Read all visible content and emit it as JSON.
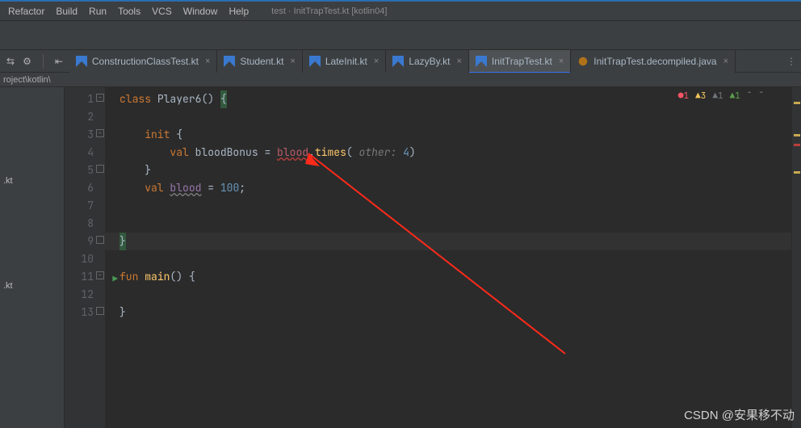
{
  "menu": {
    "items": [
      "Refactor",
      "Build",
      "Run",
      "Tools",
      "VCS",
      "Window",
      "Help"
    ],
    "title": "test · InitTrapTest.kt [kotlin04]"
  },
  "tabs": [
    {
      "label": "ConstructionClassTest.kt",
      "active": false
    },
    {
      "label": "Student.kt",
      "active": false
    },
    {
      "label": "LateInit.kt",
      "active": false
    },
    {
      "label": "LazyBy.kt",
      "active": false
    },
    {
      "label": "InitTrapTest.kt",
      "active": true
    },
    {
      "label": "InitTrapTest.decompiled.java",
      "active": false
    }
  ],
  "breadcrumb": "roject\\kotlin\\",
  "sidebar": {
    "items": [
      ".kt",
      ".kt"
    ],
    "positions": [
      128,
      260
    ]
  },
  "inspections": {
    "errors": "1",
    "warn": "3",
    "weak": "1",
    "typo": "1"
  },
  "code": {
    "l1": {
      "kw": "class",
      "name": "Player6",
      "par": "()",
      "brace": "{"
    },
    "l3": {
      "kw": "init",
      "brace": "{"
    },
    "l4": {
      "kw": "val",
      "v": "bloodBonus",
      "eq": " = ",
      "err": "blood",
      "dot": ".",
      "fn": "times",
      "lp": "(",
      "hint": " other: ",
      "num": "4",
      "rp": ")"
    },
    "l5": {
      "brace": "}"
    },
    "l6": {
      "kw": "val",
      "v": "blood",
      "eq": " = ",
      "num": "100",
      "sc": ";"
    },
    "l9": {
      "brace": "}"
    },
    "l11": {
      "kw": "fun",
      "fn": "main",
      "par": "()",
      "brace": "{"
    },
    "l13": {
      "brace": "}"
    }
  },
  "watermark": "CSDN @安果移不动"
}
